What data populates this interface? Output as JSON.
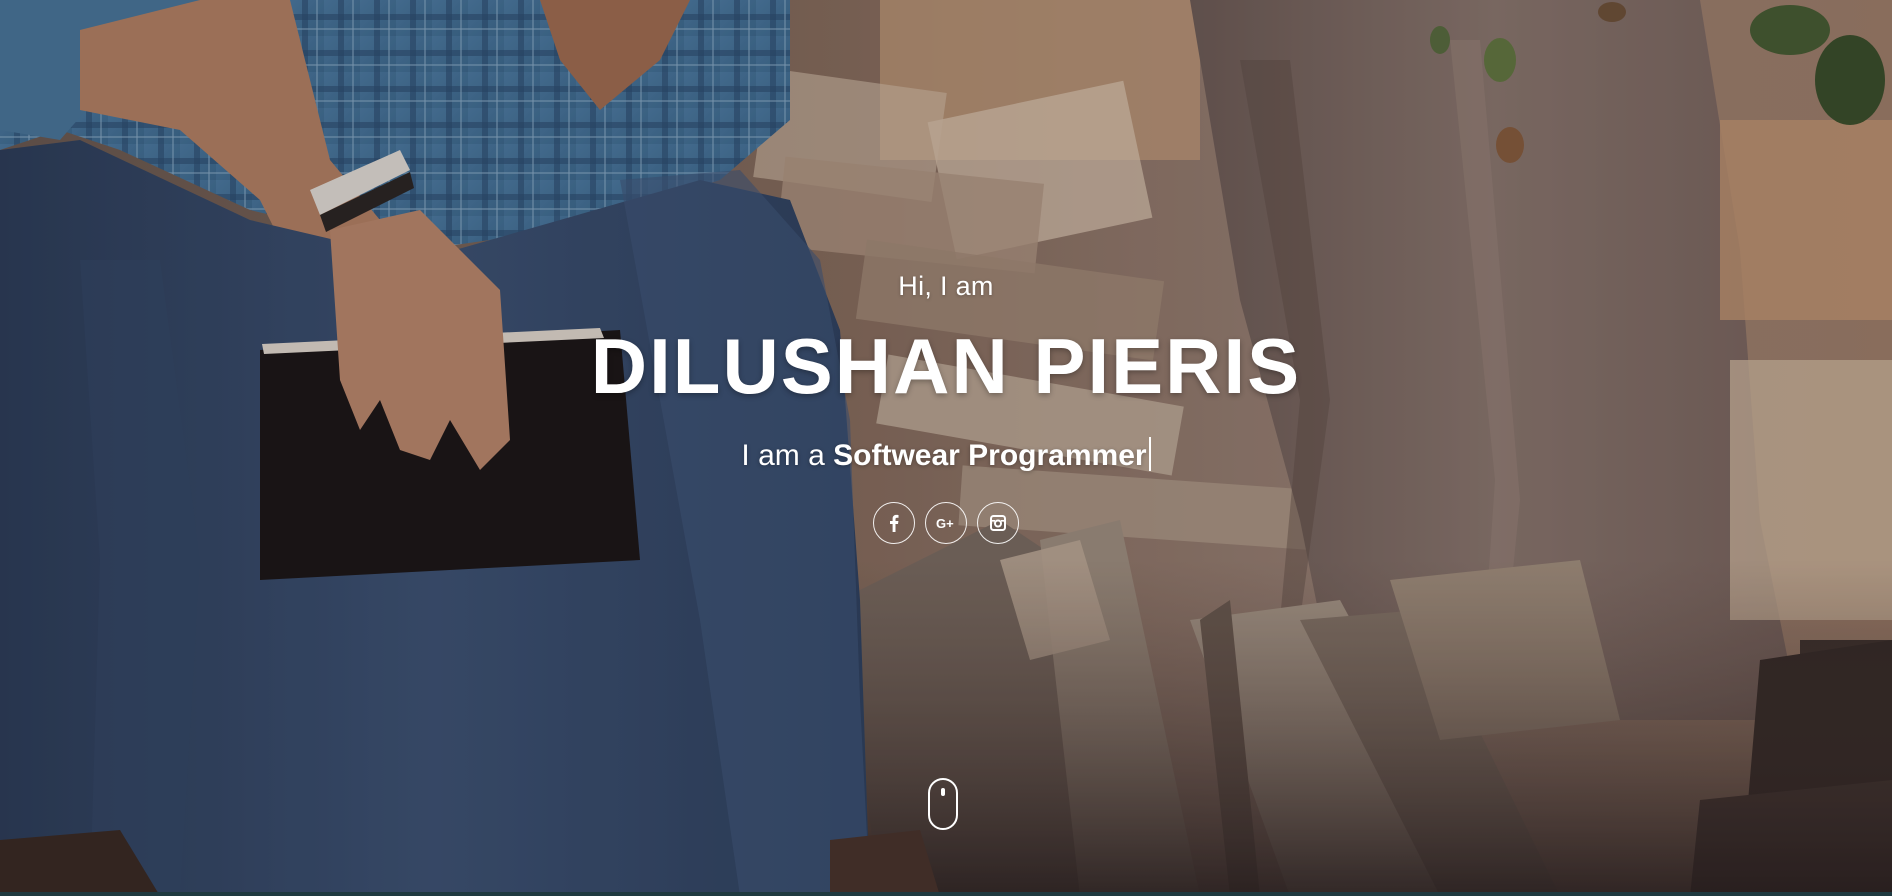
{
  "hero": {
    "greeting": "Hi, I am",
    "name": "DILUSHAN PIERIS",
    "tagline_prefix": "I am a",
    "tagline_role": "Softwear Programmer"
  },
  "socials": [
    {
      "icon": "facebook-icon",
      "glyph": "f"
    },
    {
      "icon": "google-plus-icon",
      "glyph": "G+"
    },
    {
      "icon": "instagram-icon",
      "glyph": ""
    }
  ],
  "scroll_indicator": {
    "icon": "mouse-scroll-icon"
  },
  "colors": {
    "text": "#ffffff",
    "bottom_bar": "#1f3a40",
    "overlay": "rgba(20,16,16,0.18)"
  }
}
